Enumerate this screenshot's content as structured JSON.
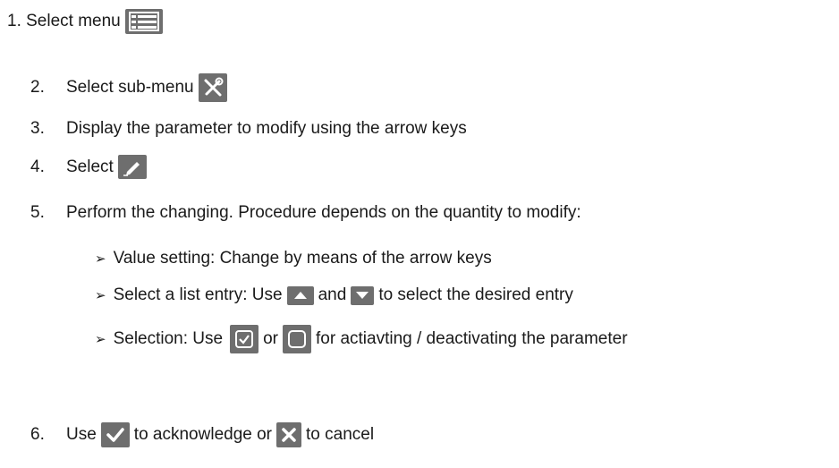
{
  "steps": {
    "s1": {
      "prefix": "1. Select menu"
    },
    "s2": {
      "num": "2.",
      "text": "Select sub-menu"
    },
    "s3": {
      "num": "3.",
      "text": "Display the parameter to modify using the arrow keys"
    },
    "s4": {
      "num": "4.",
      "text": "Select"
    },
    "s5": {
      "num": "5.",
      "text": "Perform the changing. Procedure depends on the quantity to modify:"
    },
    "s6": {
      "num": "6.",
      "a": "Use",
      "b": "to acknowledge or",
      "c": "to cancel"
    }
  },
  "bullets": {
    "b1": {
      "arrow": "➢",
      "text": "Value setting: Change by means of the arrow keys"
    },
    "b2": {
      "arrow": "➢",
      "a": "Select a list entry: Use",
      "b": "and",
      "c": "to select the desired entry"
    },
    "b3": {
      "arrow": "➢",
      "a": "Selection: Use",
      "b": "or",
      "c": "for actiavting / deactivating the parameter"
    }
  },
  "icons": {
    "menu": "list-menu-icon",
    "submenu": "tools-icon",
    "edit": "pencil-icon",
    "up": "arrow-up-icon",
    "down": "arrow-down-icon",
    "checked": "checkbox-checked-icon",
    "unchecked": "checkbox-unchecked-icon",
    "ok": "checkmark-icon",
    "cancel": "close-icon"
  },
  "colors": {
    "icon_bg": "#6e6e6e",
    "text": "#1a1a1a"
  }
}
